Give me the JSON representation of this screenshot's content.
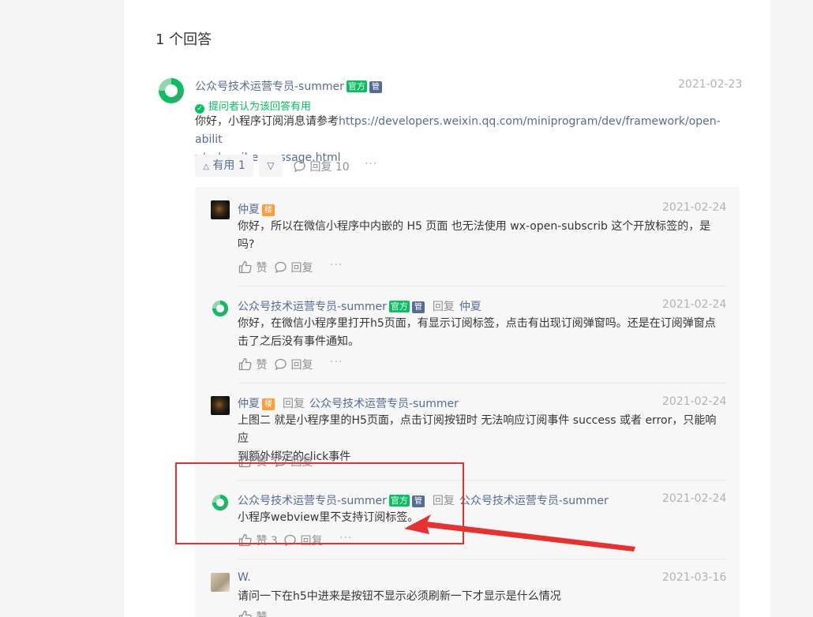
{
  "answers_title": "1 个回答",
  "main_answer": {
    "author": "公众号技术运营专员-summer",
    "official_badge": "官方",
    "admin_badge": "管",
    "date": "2021-02-23",
    "useful_note": "提问者认为该回答有用",
    "content_prefix": "你好，小程序订阅消息请参考",
    "link_line1": "https://developers.weixin.qq.com/miniprogram/dev/framework/open-abilit",
    "link_line2": "y/subscribe-message.html",
    "useful_button": "有用 1",
    "reply_button": "回复 10",
    "more": "···"
  },
  "labels": {
    "reply": "回复",
    "like": "赞",
    "lz_badge": "楼",
    "more": "···"
  },
  "replies": [
    {
      "author": "仲夏",
      "date": "2021-02-24",
      "line1": "你好，所以在微信小程序中内嵌的 H5 页面 也无法使用 wx-open-subscrib 这个开放标签的，是",
      "line2": "吗?",
      "like": "赞"
    },
    {
      "author": "公众号技术运营专员-summer",
      "reply_to": "仲夏",
      "date": "2021-02-24",
      "line1": "你好，在微信小程序里打开h5页面，有显示订阅标签，点击有出现订阅弹窗吗。还是在订阅弹窗点",
      "line2": "击了之后没有事件通知。",
      "like": "赞"
    },
    {
      "author": "仲夏",
      "reply_to": "公众号技术运营专员-summer",
      "date": "2021-02-24",
      "line1": "上图二 就是小程序里的H5页面，点击订阅按钮时 无法响应订阅事件 success 或者 error，只能响应",
      "line2": "到额外绑定的click事件",
      "like": "赞"
    },
    {
      "author": "公众号技术运营专员-summer",
      "reply_to": "公众号技术运营专员-summer",
      "date": "2021-02-24",
      "line1": "小程序webview里不支持订阅标签。",
      "like": "赞 3"
    },
    {
      "author": "W.",
      "date": "2021-03-16",
      "line1": "请问一下在h5中进来是按钮不显示必须刷新一下才显示是什么情况",
      "like": "赞"
    }
  ],
  "colors": {
    "link": "#576b95",
    "official": "#07c160",
    "lz": "#fa9d3b",
    "highlight": "#e8312f"
  }
}
